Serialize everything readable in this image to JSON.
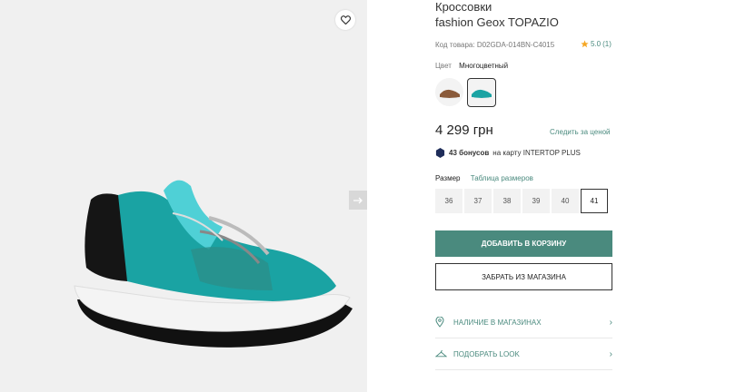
{
  "product": {
    "category": "Кроссовки",
    "name": "fashion Geox TOPAZIO",
    "sku_label": "Код товара:",
    "sku": "D02GDA-014BN-C4015",
    "rating": "5.0",
    "reviews": "(1)",
    "color_label": "Цвет",
    "color_value": "Многоцветный",
    "price": "4 299 грн",
    "watch_price": "Следить за ценой",
    "bonus_amount": "43 бонусов",
    "bonus_text": "на карту INTERTOP PLUS"
  },
  "sizes": {
    "label": "Размер",
    "table_link": "Таблица размеров",
    "options": [
      "36",
      "37",
      "38",
      "39",
      "40",
      "41"
    ],
    "selected": "41"
  },
  "actions": {
    "add_to_cart": "ДОБАВИТЬ В КОРЗИНУ",
    "pickup": "ЗАБРАТЬ ИЗ МАГАЗИНА",
    "availability": "НАЛИЧИЕ В МАГАЗИНАХ",
    "pick_look": "ПОДОБРАТЬ LOOK"
  },
  "colors": {
    "accent": "#4a8a7e",
    "star": "#f5a623"
  }
}
